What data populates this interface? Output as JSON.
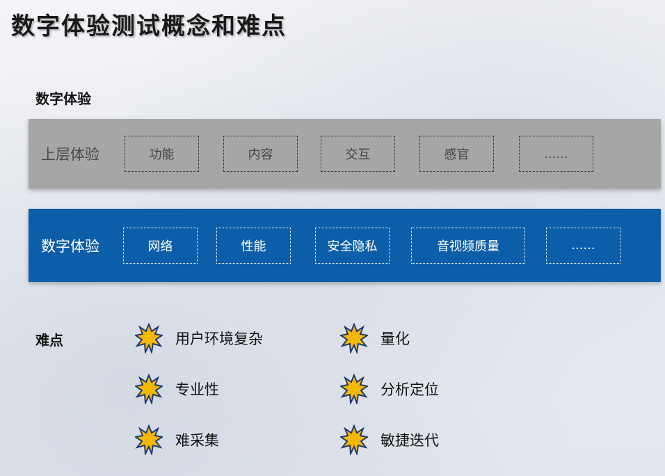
{
  "title": "数字体验测试概念和难点",
  "section_experience": "数字体验",
  "upper_layer": {
    "label": "上层体验",
    "items": [
      "功能",
      "内容",
      "交互",
      "感官",
      "......"
    ]
  },
  "digital_layer": {
    "label": "数字体验",
    "items": [
      "网络",
      "性能",
      "安全隐私",
      "音视频质量",
      "......"
    ]
  },
  "section_difficulties": "难点",
  "difficulties": [
    "用户环境复杂",
    "量化",
    "专业性",
    "分析定位",
    "难采集",
    "敏捷迭代"
  ],
  "colors": {
    "upper_band": "#a6a6a6",
    "digital_band": "#0c5ea8",
    "star_fill": "#f5b800",
    "star_outline": "#1f3b73"
  },
  "icons": {
    "difficulty_marker": "burst-star-icon"
  }
}
